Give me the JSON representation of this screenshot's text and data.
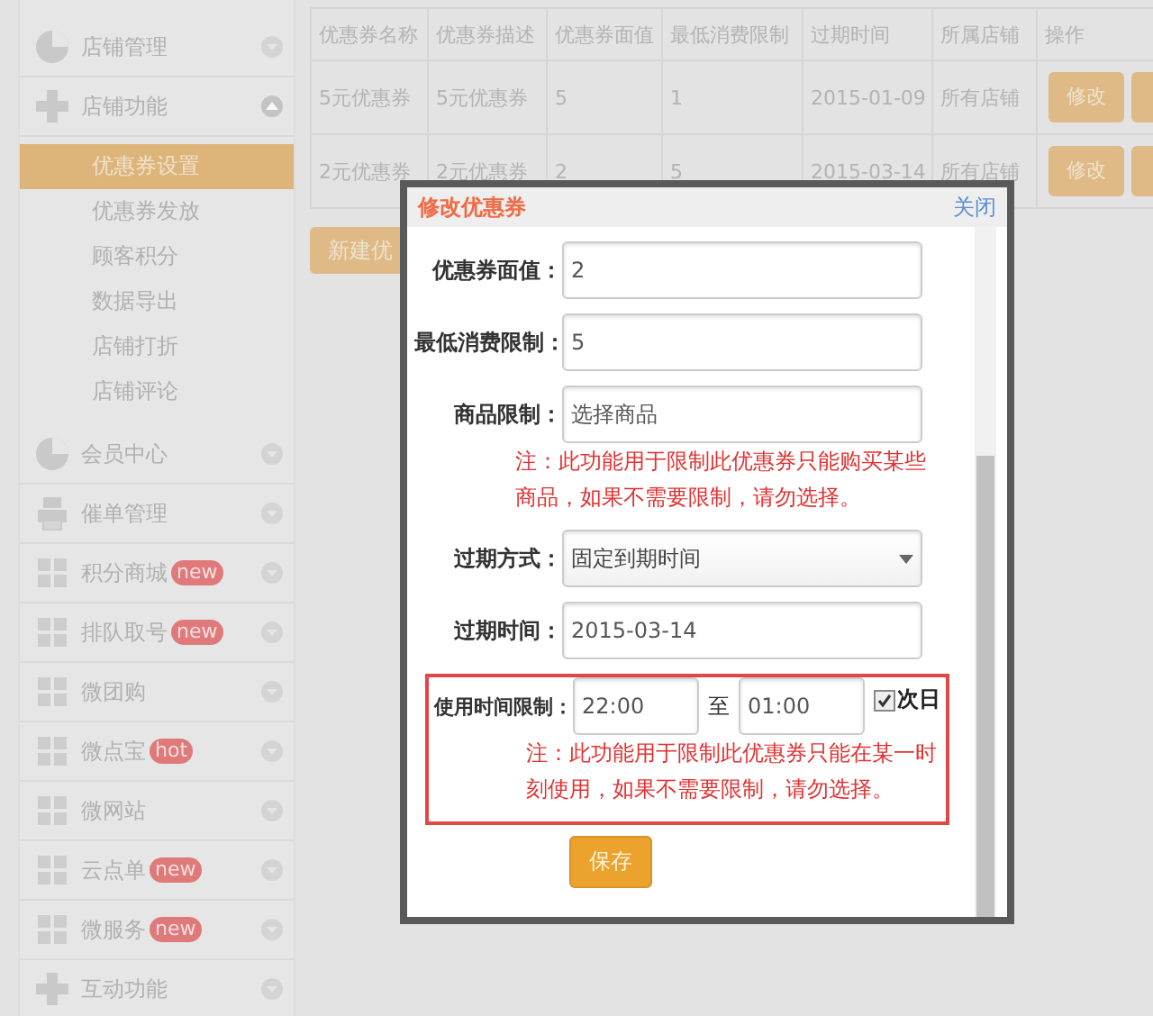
{
  "sidebar": {
    "items": [
      {
        "kind": "pie",
        "label": "店铺管理",
        "expanded": false
      },
      {
        "kind": "plus",
        "label": "店铺功能",
        "expanded": true,
        "children": [
          {
            "label": "优惠券设置",
            "selected": true
          },
          {
            "label": "优惠券发放",
            "selected": false
          },
          {
            "label": "顾客积分",
            "selected": false
          },
          {
            "label": "数据导出",
            "selected": false
          },
          {
            "label": "店铺打折",
            "selected": false
          },
          {
            "label": "店铺评论",
            "selected": false
          }
        ]
      },
      {
        "kind": "pie",
        "label": "会员中心",
        "expanded": false
      },
      {
        "kind": "printer",
        "label": "催单管理",
        "expanded": false
      },
      {
        "kind": "grid",
        "label": "积分商城",
        "badge": "new",
        "expanded": false
      },
      {
        "kind": "grid",
        "label": "排队取号",
        "badge": "new",
        "expanded": false
      },
      {
        "kind": "grid",
        "label": "微团购",
        "expanded": false
      },
      {
        "kind": "grid",
        "label": "微点宝",
        "badge": "hot",
        "expanded": false
      },
      {
        "kind": "grid",
        "label": "微网站",
        "expanded": false
      },
      {
        "kind": "grid",
        "label": "云点单",
        "badge": "new",
        "expanded": false
      },
      {
        "kind": "grid",
        "label": "微服务",
        "badge": "new",
        "expanded": false
      },
      {
        "kind": "plus",
        "label": "互动功能",
        "expanded": false
      }
    ]
  },
  "table": {
    "columns": [
      "优惠券名称",
      "优惠券描述",
      "优惠券面值",
      "最低消费限制",
      "过期时间",
      "所属店铺",
      "操作"
    ],
    "rows": [
      {
        "cells": [
          "5元优惠券",
          "5元优惠券",
          "5",
          "1",
          "2015-01-09",
          "所有店铺"
        ],
        "action": "修改"
      },
      {
        "cells": [
          "2元优惠券",
          "2元优惠券",
          "2",
          "5",
          "2015-03-14",
          "所有店铺"
        ],
        "action": "修改"
      }
    ]
  },
  "new_button": "新建优",
  "dialog": {
    "title": "修改优惠券",
    "close": "关闭",
    "fields": [
      {
        "kind": "text",
        "label": "优惠券面值：",
        "value": "2"
      },
      {
        "kind": "text",
        "label": "最低消费限制：",
        "value": "5"
      },
      {
        "kind": "text",
        "label": "商品限制：",
        "value": "选择商品",
        "note": "注：此功能用于限制此优惠券只能购买某些商品，如果不需要限制，请勿选择。"
      },
      {
        "kind": "select",
        "label": "过期方式：",
        "value": "固定到期时间"
      },
      {
        "kind": "text",
        "label": "过期时间：",
        "value": "2015-03-14"
      },
      {
        "kind": "time-range",
        "label": "使用时间限制：",
        "start": "22:00",
        "separator": "至",
        "end": "01:00",
        "checkbox": {
          "label": "次日",
          "checked": true
        },
        "highlighted": true,
        "note": "注：此功能用于限制此优惠券只能在某一时刻使用，如果不需要限制，请勿选择。"
      }
    ],
    "save": "保存"
  }
}
